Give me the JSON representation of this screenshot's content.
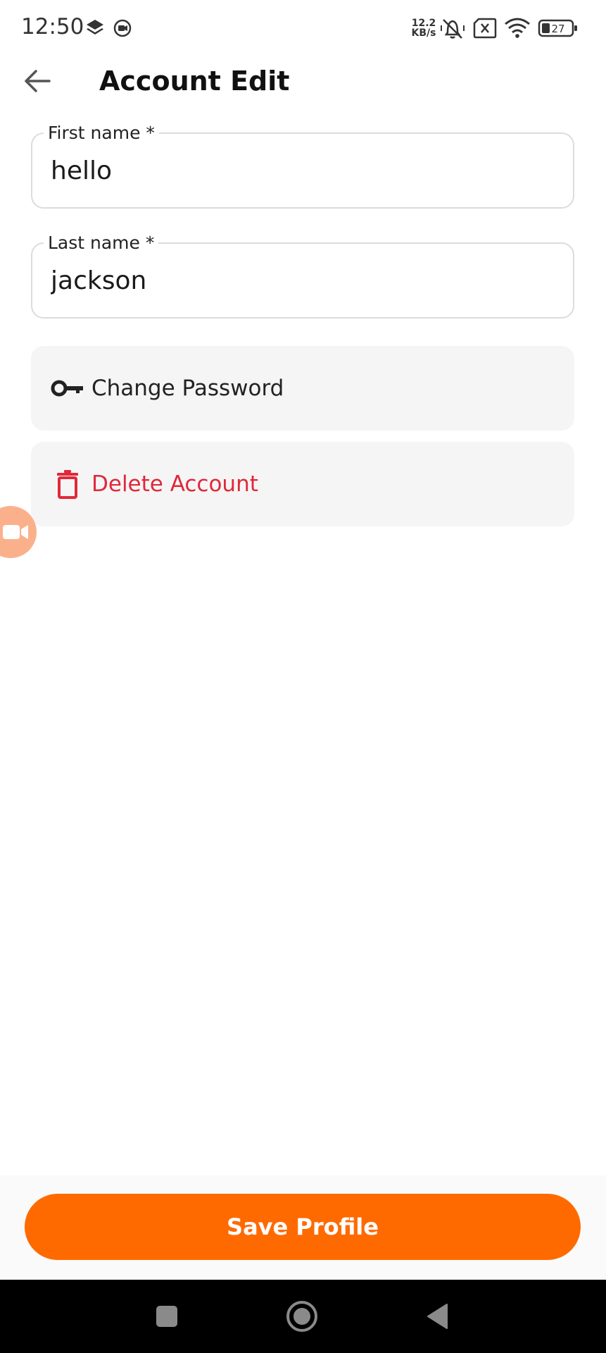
{
  "status_bar": {
    "time": "12:50",
    "net_speed_value": "12.2",
    "net_speed_unit": "KB/s",
    "battery_level": "27",
    "icons": [
      "layers-icon",
      "screen-record-icon",
      "mute-vibrate-icon",
      "no-sim-icon",
      "wifi-icon",
      "battery-icon"
    ]
  },
  "header": {
    "title": "Account Edit",
    "back_icon": "arrow-left-icon"
  },
  "form": {
    "first_name": {
      "label": "First name *",
      "value": "hello"
    },
    "last_name": {
      "label": "Last name *",
      "value": "jackson"
    }
  },
  "actions": {
    "change_password": {
      "label": "Change Password",
      "icon": "key-icon"
    },
    "delete_account": {
      "label": "Delete Account",
      "icon": "trash-icon",
      "color": "#e0283a"
    }
  },
  "floating_button": {
    "icon": "video-camera-icon",
    "color": "#fbb08c"
  },
  "footer": {
    "save_label": "Save Profile",
    "color": "#ff6a00"
  },
  "nav_bar": {
    "icons": [
      "recents-square-icon",
      "home-circle-icon",
      "back-triangle-icon"
    ]
  }
}
